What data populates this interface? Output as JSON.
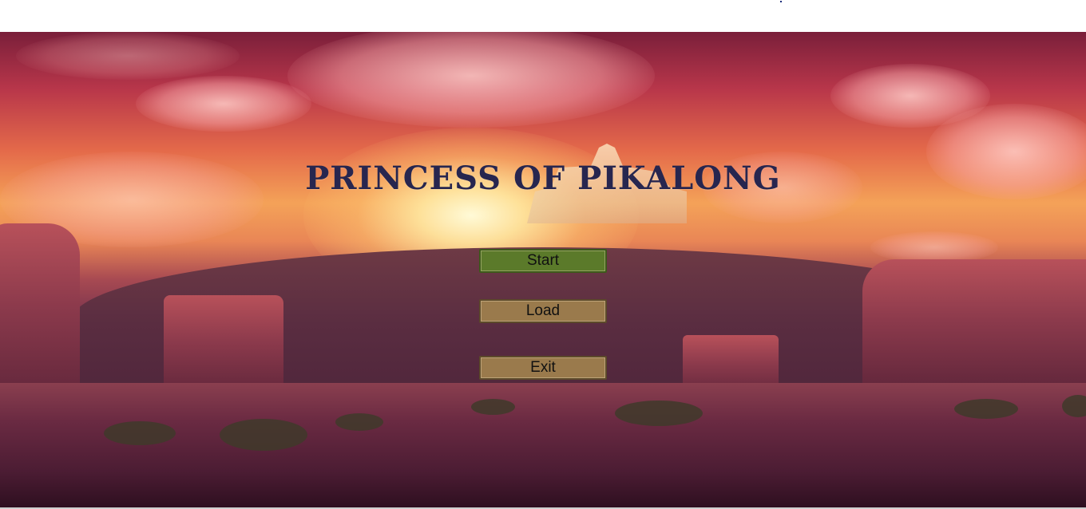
{
  "game": {
    "title": "PRINCESS OF PIKALONG"
  },
  "menu": {
    "start_label": "Start",
    "load_label": "Load",
    "exit_label": "Exit"
  },
  "colors": {
    "title": "#27264f",
    "start_button": "#5b7a2a",
    "menu_button": "#9a7a4c"
  }
}
